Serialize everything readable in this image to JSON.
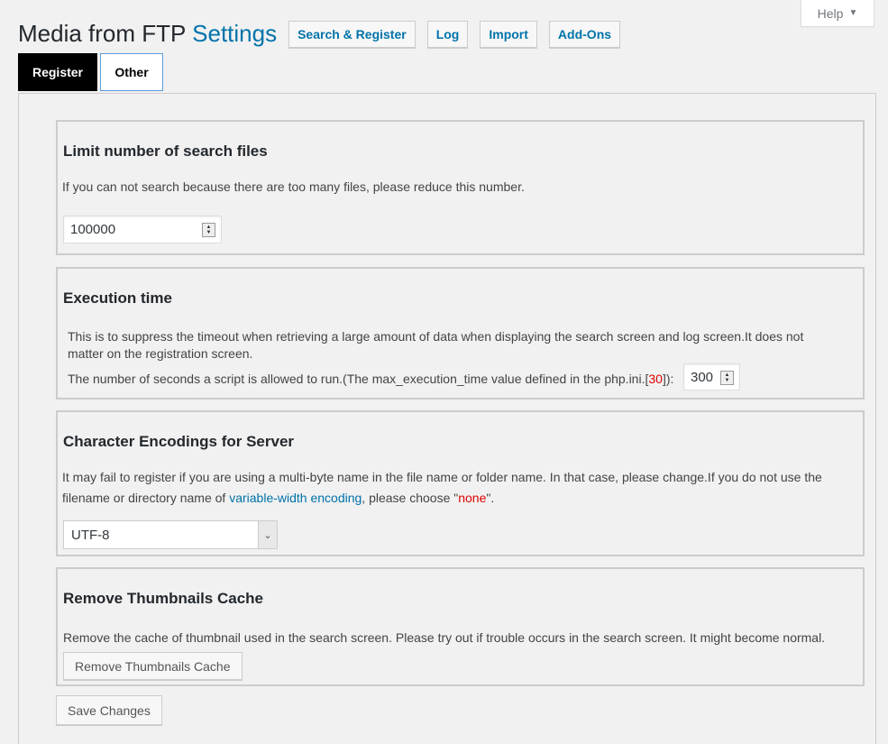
{
  "help": {
    "label": "Help"
  },
  "header": {
    "title_main": "Media from FTP",
    "title_accent": "Settings",
    "buttons": [
      "Search & Register",
      "Log",
      "Import",
      "Add-Ons"
    ]
  },
  "tabs": [
    {
      "label": "Register",
      "active": false
    },
    {
      "label": "Other",
      "active": true
    }
  ],
  "sections": {
    "limit": {
      "heading": "Limit number of search files",
      "description": "If you can not search because there are too many files, please reduce this number.",
      "value": "100000"
    },
    "execution": {
      "heading": "Execution time",
      "description": "This is to suppress the timeout when retrieving a large amount of data when displaying the search screen and log screen.It does not matter on the registration screen.",
      "line_prefix": "The number of seconds a script is allowed to run.(The max_execution_time value defined in the php.ini.[",
      "max_value": "30",
      "line_suffix": "]):",
      "value": "300"
    },
    "encoding": {
      "heading": "Character Encodings for Server",
      "description_1": "It may fail to register if you are using a multi-byte name in the file name or folder name. In that case, please change.If you do not use the filename or directory name of ",
      "link_text": "variable-width encoding",
      "description_2": ", please choose \"",
      "none_text": "none",
      "description_3": "\".",
      "selected": "UTF-8"
    },
    "thumbnails": {
      "heading": "Remove Thumbnails Cache",
      "description": "Remove the cache of thumbnail used in the search screen. Please try out if trouble occurs in the search screen. It might become normal.",
      "button_label": "Remove Thumbnails Cache"
    }
  },
  "footer": {
    "save_label": "Save Changes"
  },
  "colors": {
    "accent": "#0073aa",
    "warning": "#dd0000",
    "tab_active_bg": "#000000"
  }
}
